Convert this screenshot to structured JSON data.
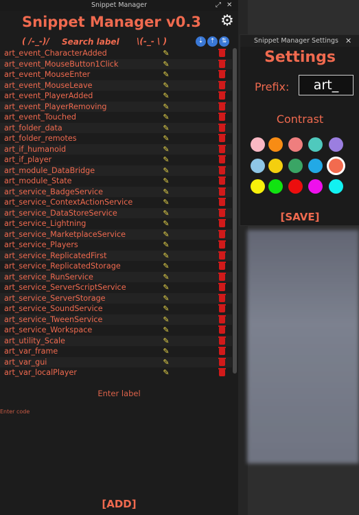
{
  "main_window": {
    "title": "Snippet Manager",
    "app_title": "Snippet Manager v0.3",
    "search": {
      "face_left": "( /-_-)/",
      "placeholder": "Search label",
      "face_right": "\\(-_- \\ )"
    },
    "sort_buttons": [
      "sort-ascending-icon",
      "sort-descending-icon",
      "swap-icon"
    ],
    "snippets": [
      "art_event_CharacterAdded",
      "art_event_MouseButton1Click",
      "art_event_MouseEnter",
      "art_event_MouseLeave",
      "art_event_PlayerAdded",
      "art_event_PlayerRemoving",
      "art_event_Touched",
      "art_folder_data",
      "art_folder_remotes",
      "art_if_humanoid",
      "art_if_player",
      "art_module_DataBridge",
      "art_module_State",
      "art_service_BadgeService",
      "art_service_ContextActionService",
      "art_service_DataStoreService",
      "art_service_Lightning",
      "art_service_MarketplaceService",
      "art_service_Players",
      "art_service_ReplicatedFirst",
      "art_service_ReplicatedStorage",
      "art_service_RunService",
      "art_service_ServerScriptService",
      "art_service_ServerStorage",
      "art_service_SoundService",
      "art_service_TweenService",
      "art_service_Workspace",
      "art_utility_Scale",
      "art_var_frame",
      "art_var_gui",
      "art_var_localPlayer"
    ],
    "label_placeholder": "Enter label",
    "code_placeholder": "Enter code",
    "add_label": "[ADD]"
  },
  "settings_window": {
    "title": "Snippet Manager Settings",
    "heading": "Settings",
    "prefix_label": "Prefix:",
    "prefix_value": "art_",
    "contrast_label": "Contrast",
    "colors": [
      "#f9b8c3",
      "#f88c14",
      "#ef7e7e",
      "#4fc9bd",
      "#9b7ee0",
      "#8ec6e6",
      "#f4cf0f",
      "#3aa565",
      "#22a9e6",
      "#f26b4f",
      "#f8f00b",
      "#11e311",
      "#ec0e0e",
      "#ee10ec",
      "#12f1f1"
    ],
    "selected_color": "#f26b4f",
    "save_label": "[SAVE]"
  },
  "colors": {
    "accent": "#f06a4f",
    "edit": "#e8d64a",
    "delete": "#d11a1a",
    "sort": "#3a78d6"
  }
}
